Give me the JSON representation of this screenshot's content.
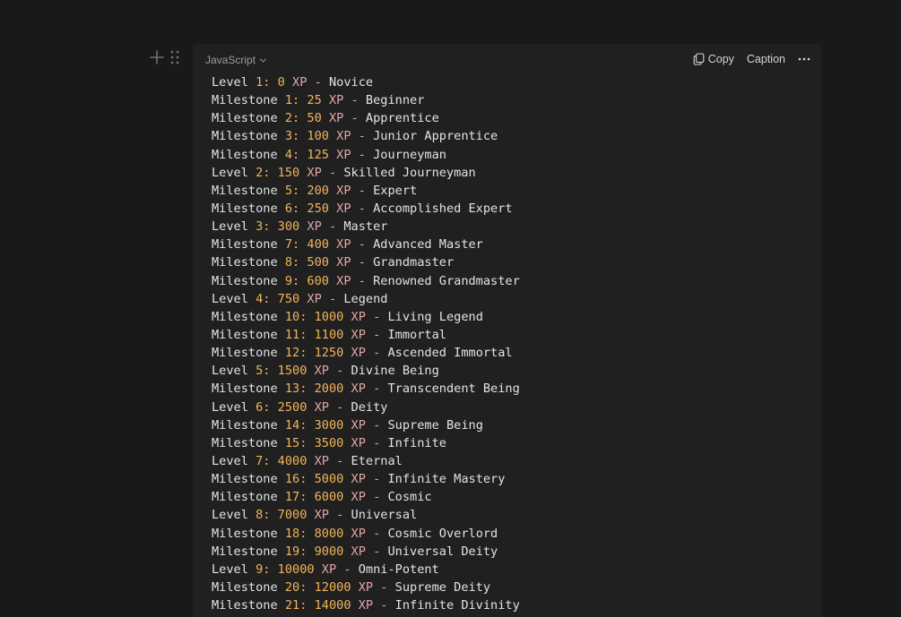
{
  "code_block": {
    "language": "JavaScript",
    "toolbar": {
      "copy_label": "Copy",
      "caption_label": "Caption",
      "more_icon": "more-horizontal-icon"
    },
    "icons": {
      "add": "plus-icon",
      "drag": "drag-handle-icon",
      "copy": "copy-icon",
      "language_dropdown": "chevron-down-icon"
    },
    "colors": {
      "background": "#191919",
      "block_background": "#202020",
      "text": "#e3e3e3",
      "number": "#f2b45a",
      "unit_and_operator": "#e4a4a6"
    },
    "lines": [
      {
        "label": "Level",
        "num": "1",
        "xp": "0",
        "title": "Novice"
      },
      {
        "label": "Milestone",
        "num": "1",
        "xp": "25",
        "title": "Beginner"
      },
      {
        "label": "Milestone",
        "num": "2",
        "xp": "50",
        "title": "Apprentice"
      },
      {
        "label": "Milestone",
        "num": "3",
        "xp": "100",
        "title": "Junior Apprentice"
      },
      {
        "label": "Milestone",
        "num": "4",
        "xp": "125",
        "title": "Journeyman"
      },
      {
        "label": "Level",
        "num": "2",
        "xp": "150",
        "title": "Skilled Journeyman"
      },
      {
        "label": "Milestone",
        "num": "5",
        "xp": "200",
        "title": "Expert"
      },
      {
        "label": "Milestone",
        "num": "6",
        "xp": "250",
        "title": "Accomplished Expert"
      },
      {
        "label": "Level",
        "num": "3",
        "xp": "300",
        "title": "Master"
      },
      {
        "label": "Milestone",
        "num": "7",
        "xp": "400",
        "title": "Advanced Master"
      },
      {
        "label": "Milestone",
        "num": "8",
        "xp": "500",
        "title": "Grandmaster"
      },
      {
        "label": "Milestone",
        "num": "9",
        "xp": "600",
        "title": "Renowned Grandmaster"
      },
      {
        "label": "Level",
        "num": "4",
        "xp": "750",
        "title": "Legend"
      },
      {
        "label": "Milestone",
        "num": "10",
        "xp": "1000",
        "title": "Living Legend"
      },
      {
        "label": "Milestone",
        "num": "11",
        "xp": "1100",
        "title": "Immortal"
      },
      {
        "label": "Milestone",
        "num": "12",
        "xp": "1250",
        "title": "Ascended Immortal"
      },
      {
        "label": "Level",
        "num": "5",
        "xp": "1500",
        "title": "Divine Being"
      },
      {
        "label": "Milestone",
        "num": "13",
        "xp": "2000",
        "title": "Transcendent Being"
      },
      {
        "label": "Level",
        "num": "6",
        "xp": "2500",
        "title": "Deity"
      },
      {
        "label": "Milestone",
        "num": "14",
        "xp": "3000",
        "title": "Supreme Being"
      },
      {
        "label": "Milestone",
        "num": "15",
        "xp": "3500",
        "title": "Infinite"
      },
      {
        "label": "Level",
        "num": "7",
        "xp": "4000",
        "title": "Eternal"
      },
      {
        "label": "Milestone",
        "num": "16",
        "xp": "5000",
        "title": "Infinite Mastery"
      },
      {
        "label": "Milestone",
        "num": "17",
        "xp": "6000",
        "title": "Cosmic"
      },
      {
        "label": "Level",
        "num": "8",
        "xp": "7000",
        "title": "Universal"
      },
      {
        "label": "Milestone",
        "num": "18",
        "xp": "8000",
        "title": "Cosmic Overlord"
      },
      {
        "label": "Milestone",
        "num": "19",
        "xp": "9000",
        "title": "Universal Deity"
      },
      {
        "label": "Level",
        "num": "9",
        "xp": "10000",
        "title": "Omni-Potent"
      },
      {
        "label": "Milestone",
        "num": "20",
        "xp": "12000",
        "title": "Supreme Deity"
      },
      {
        "label": "Milestone",
        "num": "21",
        "xp": "14000",
        "title": "Infinite Divinity"
      }
    ]
  }
}
